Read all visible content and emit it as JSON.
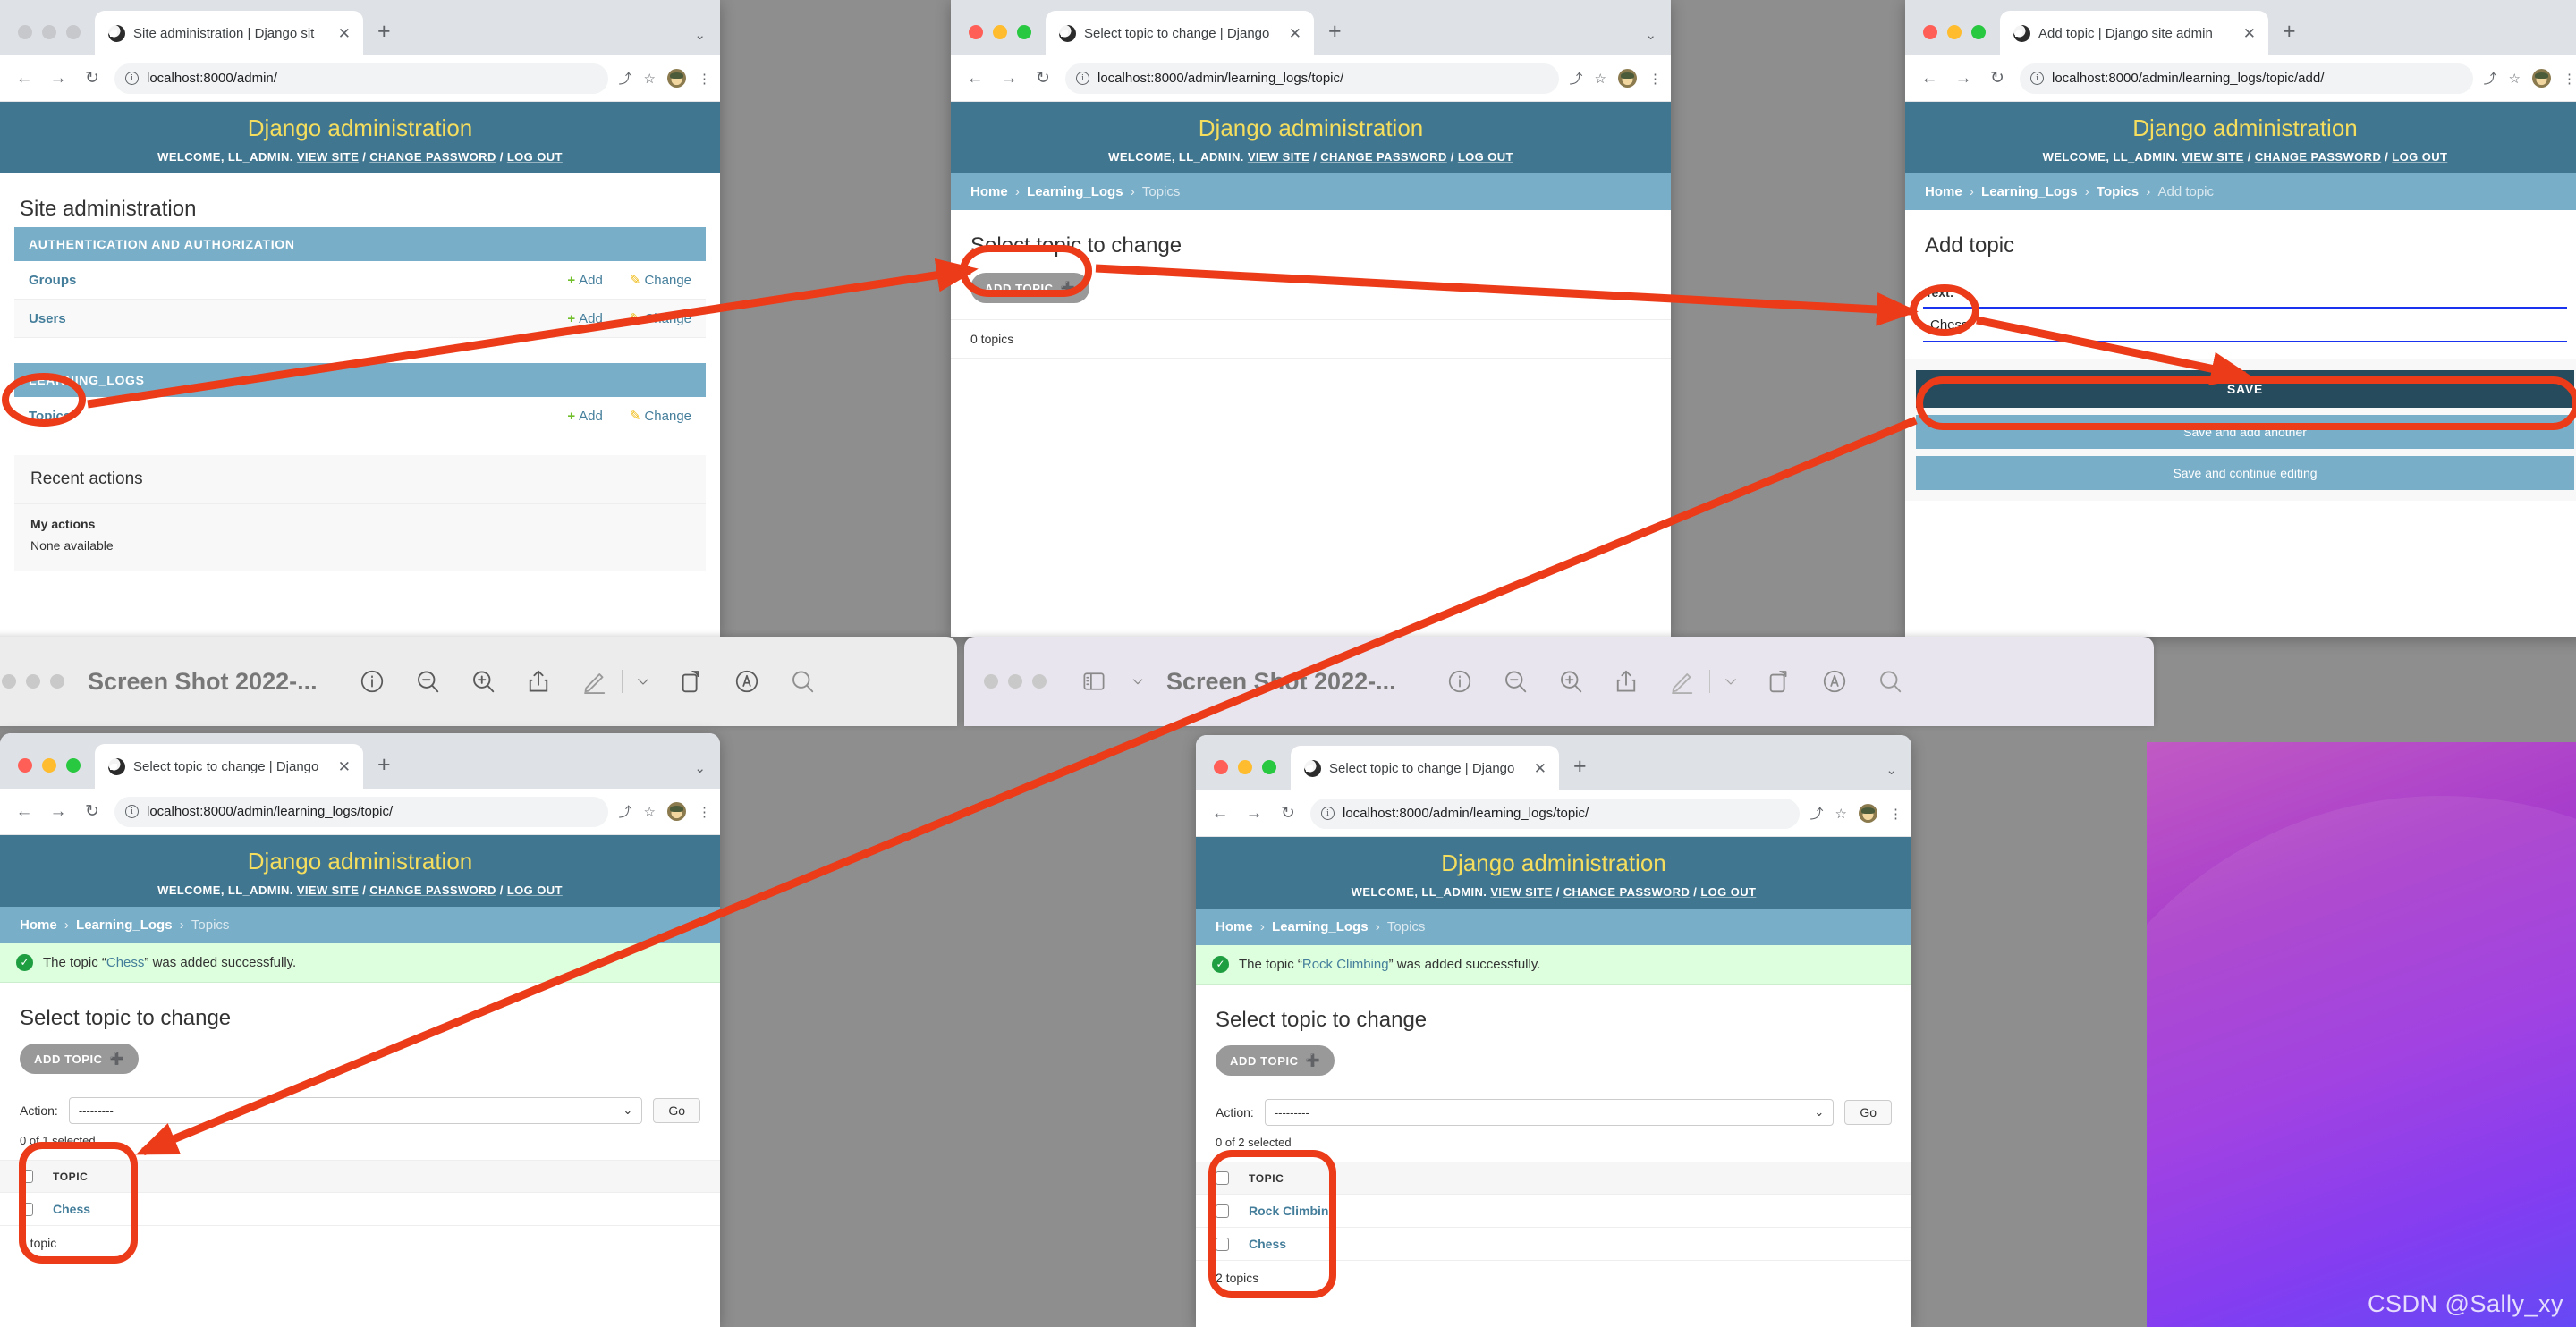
{
  "desktop": {
    "watermark": "CSDN @Sally_xy"
  },
  "common": {
    "django_title": "Django administration",
    "usertools_prefix": "WELCOME,",
    "username": "LL_ADMIN.",
    "view_site": "VIEW SITE",
    "change_password": "CHANGE PASSWORD",
    "log_out": "LOG OUT",
    "sep": "/",
    "back_icon": "←",
    "forward_icon": "→",
    "reload_icon": "↻",
    "share_icon": "⤴",
    "star_icon": "☆",
    "menu_icon": "⋮",
    "newtab_icon": "+",
    "close_icon": "✕",
    "chevron_down": "⌄",
    "info_icon": "i",
    "breadcrumb_sep": "›"
  },
  "window1": {
    "tab_title": "Site administration | Django sit",
    "url": "localhost:8000/admin/",
    "page_title": "Site administration",
    "modules": [
      {
        "name": "AUTHENTICATION AND AUTHORIZATION",
        "rows": [
          {
            "label": "Groups",
            "add": "Add",
            "change": "Change"
          },
          {
            "label": "Users",
            "add": "Add",
            "change": "Change"
          }
        ]
      },
      {
        "name": "LEARNING_LOGS",
        "rows": [
          {
            "label": "Topics",
            "add": "Add",
            "change": "Change"
          }
        ]
      }
    ],
    "recent": {
      "title": "Recent actions",
      "subtitle": "My actions",
      "empty": "None available"
    }
  },
  "window2": {
    "tab_title": "Select topic to change | Django",
    "url": "localhost:8000/admin/learning_logs/topic/",
    "breadcrumbs": [
      "Home",
      "Learning_Logs",
      "Topics"
    ],
    "page_title": "Select topic to change",
    "add_button": "ADD TOPIC",
    "count": "0 topics"
  },
  "window3": {
    "tab_title": "Add topic | Django site admin",
    "url": "localhost:8000/admin/learning_logs/topic/add/",
    "breadcrumbs": [
      "Home",
      "Learning_Logs",
      "Topics",
      "Add topic"
    ],
    "page_title": "Add topic",
    "field_label": "Text:",
    "field_value": "Chess",
    "save_label": "SAVE",
    "save_add_another_label": "Save and add another",
    "save_continue_label": "Save and continue editing"
  },
  "window4": {
    "preview_title": "Screen Shot 2022-...",
    "tab_title": "Select topic to change | Django",
    "url": "localhost:8000/admin/learning_logs/topic/",
    "breadcrumbs": [
      "Home",
      "Learning_Logs",
      "Topics"
    ],
    "success_prefix": "The topic “",
    "success_value": "Chess",
    "success_suffix": "” was added successfully.",
    "page_title": "Select topic to change",
    "add_button": "ADD TOPIC",
    "action_label": "Action:",
    "action_value": "---------",
    "go_label": "Go",
    "selected_text": "0 of 1 selected",
    "column_header": "TOPIC",
    "rows": [
      "Chess"
    ],
    "count": "1 topic"
  },
  "window5": {
    "preview_title": "Screen Shot 2022-...",
    "tab_title": "Select topic to change | Django",
    "url": "localhost:8000/admin/learning_logs/topic/",
    "breadcrumbs": [
      "Home",
      "Learning_Logs",
      "Topics"
    ],
    "success_prefix": "The topic “",
    "success_value": "Rock Climbing",
    "success_suffix": "” was added successfully.",
    "page_title": "Select topic to change",
    "add_button": "ADD TOPIC",
    "action_label": "Action:",
    "action_value": "---------",
    "go_label": "Go",
    "selected_text": "0 of 2 selected",
    "column_header": "TOPIC",
    "rows": [
      "Rock Climbing",
      "Chess"
    ],
    "count": "2 topics"
  },
  "annotation": {
    "color": "#eb3b19",
    "highlights": [
      "Topics",
      "ADD TOPIC",
      "Chess",
      "SAVE",
      "topic-table-1",
      "topic-table-2"
    ]
  }
}
